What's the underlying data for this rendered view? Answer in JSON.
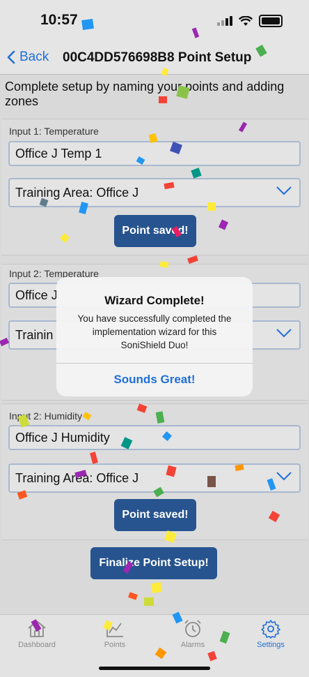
{
  "status_bar": {
    "time": "10:57"
  },
  "nav": {
    "back_label": "Back",
    "title": "00C4DD576698B8 Point Setup"
  },
  "intro_text": "Complete setup by naming your points and adding zones",
  "inputs": [
    {
      "label": "Input 1: Temperature",
      "name_value": "Office J Temp 1",
      "zone_value": "Training Area: Office J",
      "saved_label": "Point saved!"
    },
    {
      "label": "Input 2: Temperature",
      "name_value": "Office J",
      "zone_value": "Trainin"
    },
    {
      "label": "Input 2: Humidity",
      "name_value": "Office J Humidity",
      "zone_value": "Training Area: Office J",
      "saved_label": "Point saved!"
    }
  ],
  "finalize_label": "Finalize Point Setup!",
  "alert": {
    "title": "Wizard Complete!",
    "message": "You have successfully completed the implementation wizard for this SoniShield Duo!",
    "button_label": "Sounds Great!"
  },
  "tabs": [
    {
      "label": "Dashboard",
      "icon": "house-icon"
    },
    {
      "label": "Points",
      "icon": "chart-icon"
    },
    {
      "label": "Alarms",
      "icon": "alarm-clock-icon"
    },
    {
      "label": "Settings",
      "icon": "gear-icon",
      "active": true
    }
  ],
  "colors": {
    "accent": "#1f6fd8",
    "button": "#27548f"
  }
}
